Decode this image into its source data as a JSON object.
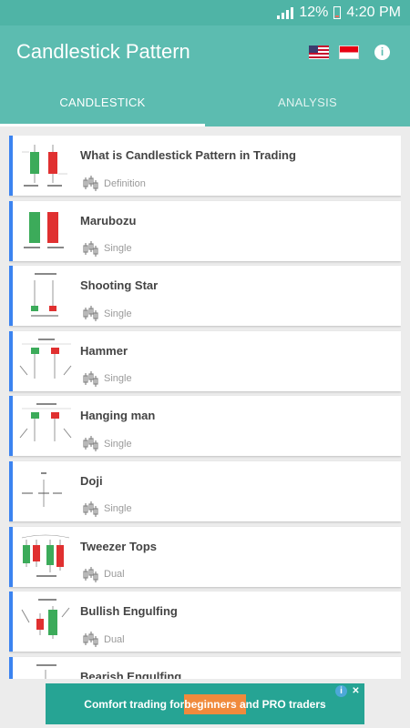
{
  "status": {
    "battery": "12%",
    "time": "4:20 PM"
  },
  "app": {
    "title": "Candlestick Pattern"
  },
  "tabs": [
    {
      "label": "CANDLESTICK"
    },
    {
      "label": "ANALYSIS"
    }
  ],
  "patterns": [
    {
      "title": "What is Candlestick Pattern in Trading",
      "category": "Definition"
    },
    {
      "title": "Marubozu",
      "category": "Single"
    },
    {
      "title": "Shooting Star",
      "category": "Single"
    },
    {
      "title": "Hammer",
      "category": "Single"
    },
    {
      "title": "Hanging man",
      "category": "Single"
    },
    {
      "title": "Doji",
      "category": "Single"
    },
    {
      "title": "Tweezer Tops",
      "category": "Dual"
    },
    {
      "title": "Bullish Engulfing",
      "category": "Dual"
    },
    {
      "title": "Bearish Engulfing",
      "category": ""
    }
  ],
  "ad": {
    "text_before": "Comfort trading for ",
    "text_highlight": "beginners a",
    "text_after": "nd PRO traders"
  },
  "colors": {
    "primary": "#5cbcb0",
    "accent": "#3b83f0",
    "bull": "#3cab5a",
    "bear": "#e03030"
  }
}
